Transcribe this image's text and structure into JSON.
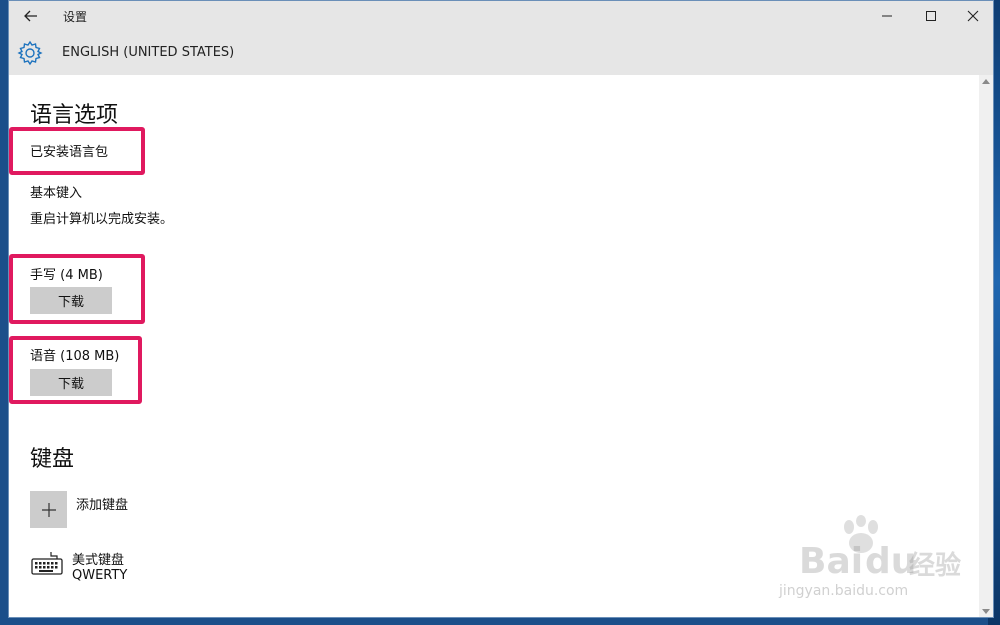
{
  "window": {
    "title": "设置"
  },
  "header": {
    "title": "ENGLISH (UNITED STATES)"
  },
  "language_options": {
    "heading": "语言选项",
    "installed_pack": "已安装语言包",
    "basic_typing": "基本键入",
    "restart_note": "重启计算机以完成安装。",
    "handwriting": {
      "label": "手写 (4 MB)",
      "button": "下载"
    },
    "speech": {
      "label": "语音 (108 MB)",
      "button": "下载"
    }
  },
  "keyboards": {
    "heading": "键盘",
    "add_label": "添加键盘",
    "items": [
      {
        "name": "美式键盘",
        "layout": "QWERTY"
      }
    ]
  },
  "watermark": {
    "brand": "Bai",
    "brand2": "du",
    "cn": "经验",
    "url": "jingyan.baidu.com"
  },
  "colors": {
    "highlight": "#e0195f",
    "accent": "#1e73be"
  }
}
